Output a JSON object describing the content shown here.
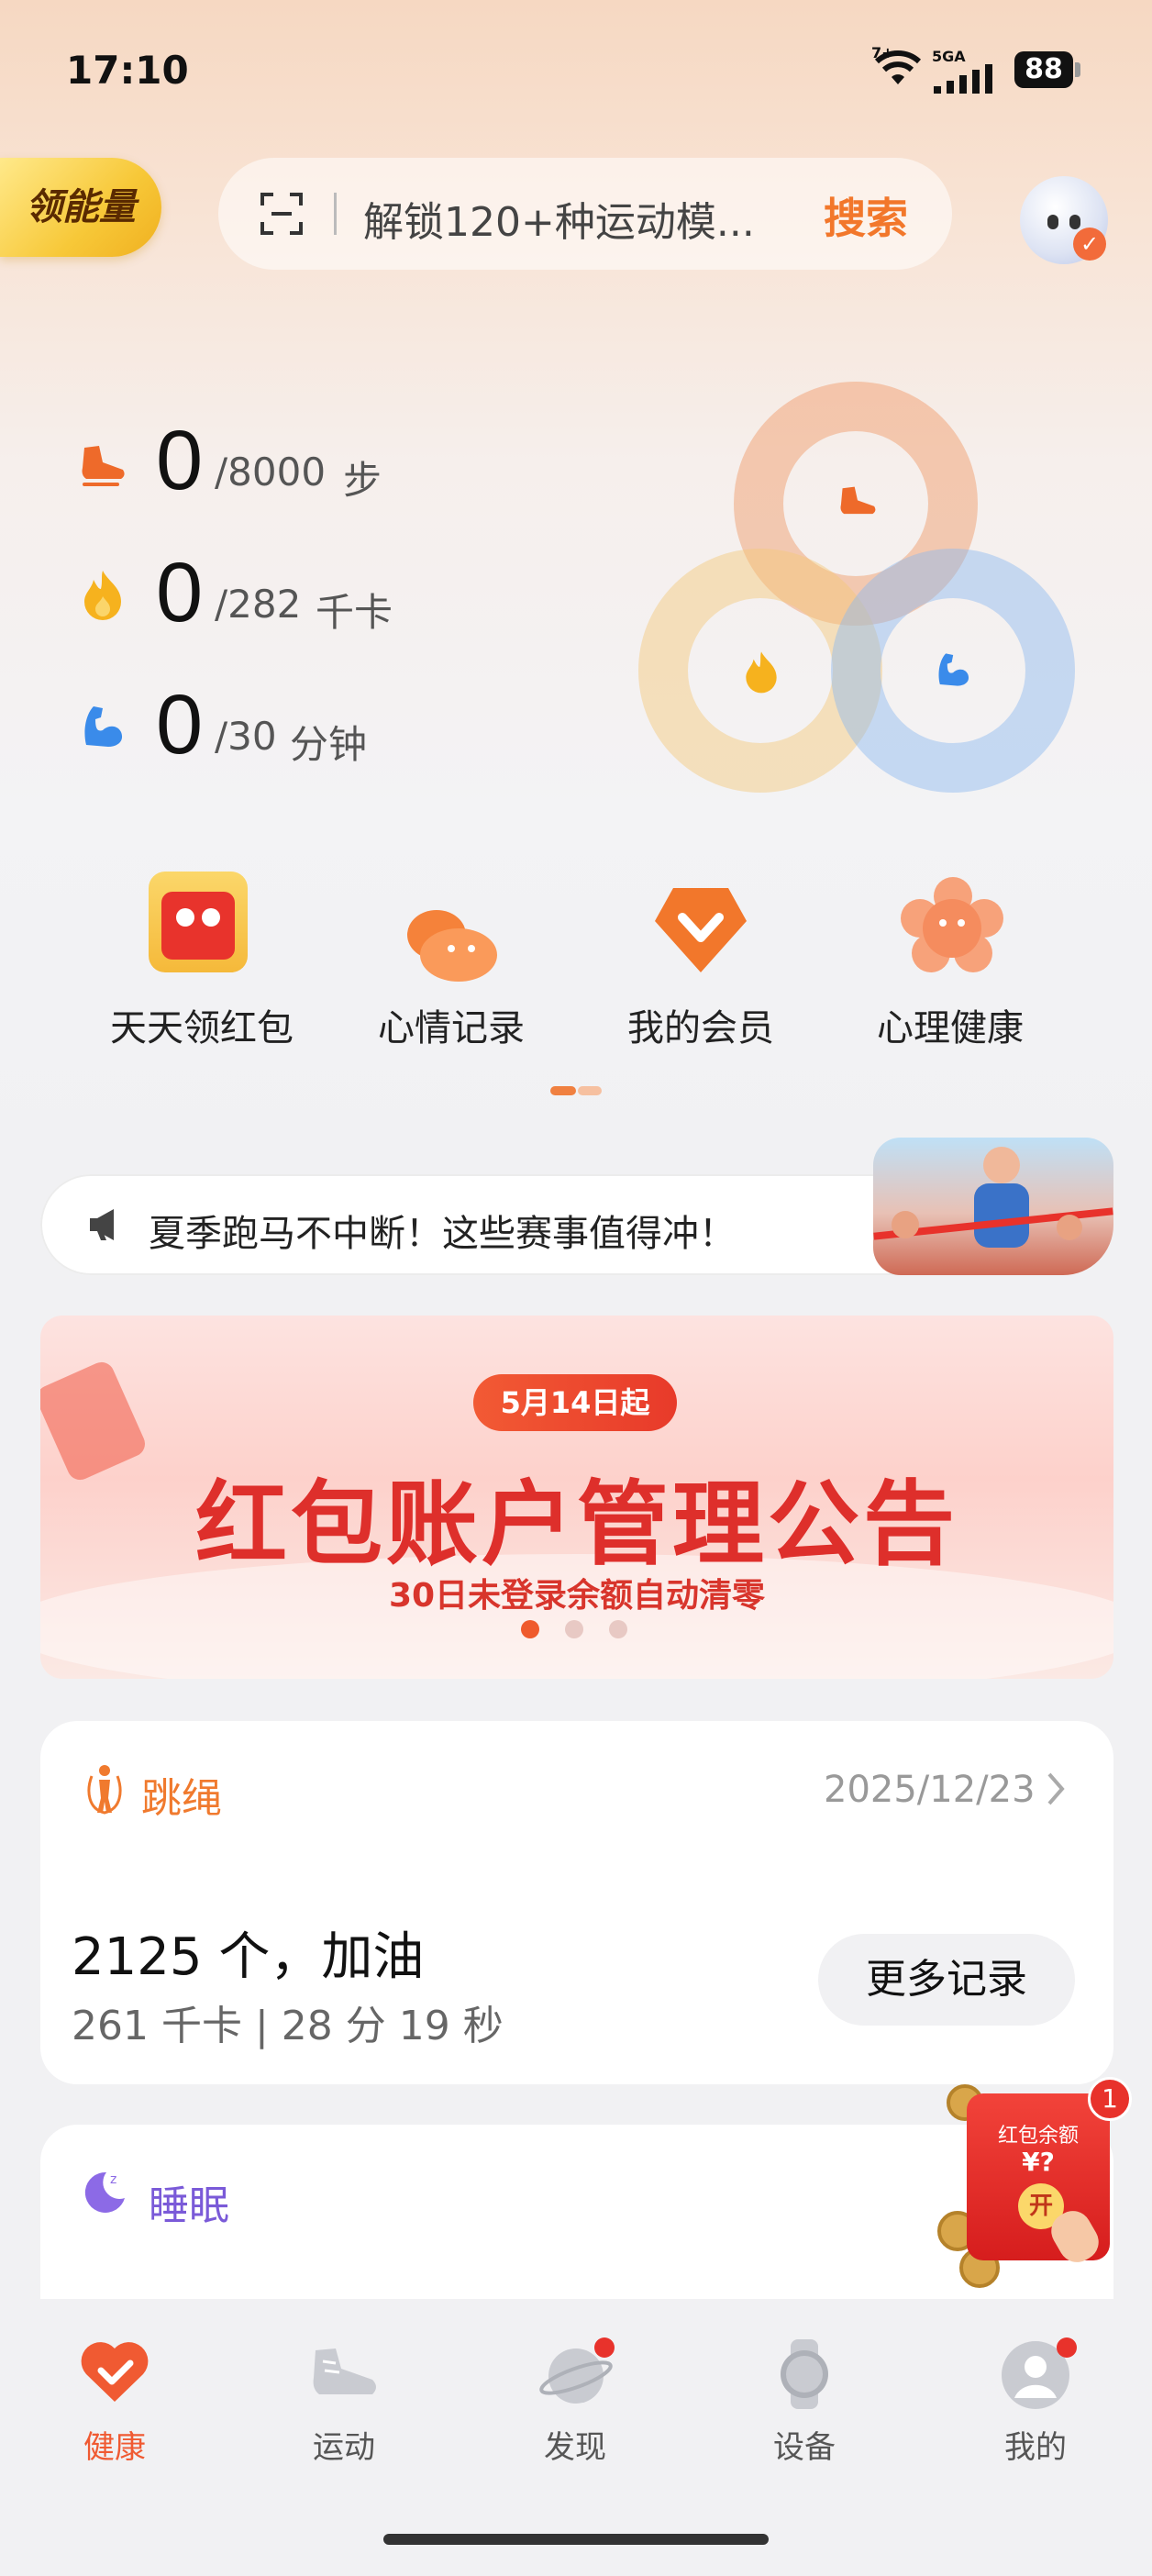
{
  "status_bar": {
    "time": "17:10",
    "network_small": "7+",
    "network_label": "5GA",
    "battery": "88"
  },
  "header": {
    "energy_label": "领能量",
    "search_placeholder": "解锁120+种运动模...",
    "search_button": "搜索"
  },
  "stats": [
    {
      "icon": "shoe-icon",
      "value": "0",
      "goal": "/8000",
      "unit": "步",
      "color": "#ee6a2a"
    },
    {
      "icon": "flame-icon",
      "value": "0",
      "goal": "/282",
      "unit": "千卡",
      "color": "#f6b21e"
    },
    {
      "icon": "muscle-icon",
      "value": "0",
      "goal": "/30",
      "unit": "分钟",
      "color": "#3a8bea"
    }
  ],
  "quick_actions": [
    {
      "label": "天天领红包",
      "icon": "red-packet-icon"
    },
    {
      "label": "心情记录",
      "icon": "mood-icon"
    },
    {
      "label": "我的会员",
      "icon": "vip-icon"
    },
    {
      "label": "心理健康",
      "icon": "flower-icon"
    }
  ],
  "notice": {
    "text": "夏季跑马不中断！这些赛事值得冲！"
  },
  "banner": {
    "pill": "5月14日起",
    "title": "红包账户管理公告",
    "subtitle": "30日未登录余额自动清零",
    "active_dot": 1,
    "dots": 3
  },
  "jump_rope_card": {
    "title": "跳绳",
    "date": "2025/12/23",
    "main": "2125 个，加油",
    "sub": "261 千卡 | 28 分 19 秒",
    "more_button": "更多记录"
  },
  "sleep_card": {
    "title": "睡眠"
  },
  "floating_red_packet": {
    "title": "红包余额",
    "amount": "¥?",
    "open": "开",
    "badge": "1"
  },
  "tabbar": [
    {
      "label": "健康",
      "active": true,
      "dot": false
    },
    {
      "label": "运动",
      "active": false,
      "dot": false
    },
    {
      "label": "发现",
      "active": false,
      "dot": true
    },
    {
      "label": "设备",
      "active": false,
      "dot": false
    },
    {
      "label": "我的",
      "active": false,
      "dot": true
    }
  ],
  "colors": {
    "accent": "#f2772b",
    "steps": "#ee6a2a",
    "calories": "#f6b21e",
    "minutes": "#3a8bea",
    "tab_active": "#f05a32"
  }
}
